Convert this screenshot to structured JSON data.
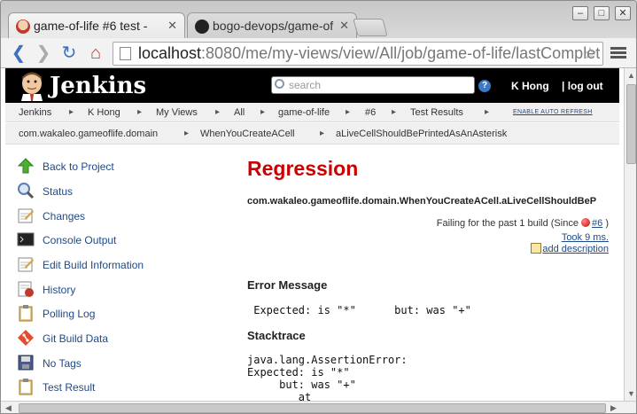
{
  "browser": {
    "tabs": [
      {
        "title": "game-of-life #6 test -",
        "active": true
      },
      {
        "title": "bogo-devops/game-of",
        "active": false
      }
    ],
    "url_host": "localhost",
    "url_rest": ":8080/me/my-views/view/All/job/game-of-life/lastComplet"
  },
  "jenkins": {
    "title": "Jenkins",
    "search_placeholder": "search",
    "user": "K Hong",
    "logout": "| log out"
  },
  "breadcrumbs": [
    "Jenkins",
    "K Hong",
    "My Views",
    "All",
    "game-of-life",
    "#6",
    "Test Results"
  ],
  "auto_refresh": "ENABLE AUTO REFRESH",
  "breadcrumbs2": [
    "com.wakaleo.gameoflife.domain",
    "WhenYouCreateACell",
    "aLiveCellShouldBePrintedAsAnAsterisk"
  ],
  "sidebar": {
    "items": [
      {
        "label": "Back to Project",
        "icon": "up-arrow-icon"
      },
      {
        "label": "Status",
        "icon": "magnifier-icon"
      },
      {
        "label": "Changes",
        "icon": "notepad-icon"
      },
      {
        "label": "Console Output",
        "icon": "terminal-icon"
      },
      {
        "label": "Edit Build Information",
        "icon": "notepad-pencil-icon"
      },
      {
        "label": "History",
        "icon": "history-icon"
      },
      {
        "label": "Polling Log",
        "icon": "clipboard-icon"
      },
      {
        "label": "Git Build Data",
        "icon": "git-icon"
      },
      {
        "label": "No Tags",
        "icon": "floppy-icon"
      },
      {
        "label": "Test Result",
        "icon": "clipboard-icon"
      }
    ]
  },
  "main": {
    "heading": "Regression",
    "test_name": "com.wakaleo.gameoflife.domain.WhenYouCreateACell.aLiveCellShouldBeP",
    "failing_prefix": "Failing for the past 1 build (Since ",
    "failing_link": "#6",
    "failing_suffix": " )",
    "took": "Took 9 ms.",
    "add_description": "add description",
    "error_heading": "Error Message",
    "error_text": " Expected: is \"*\"      but: was \"+\"",
    "stack_heading": "Stacktrace",
    "stack_text": "java.lang.AssertionError:\nExpected: is \"*\"\n     but: was \"+\"\n        at"
  },
  "colors": {
    "regression": "#cc0000",
    "link": "#204a87",
    "header_bg": "#000000"
  }
}
